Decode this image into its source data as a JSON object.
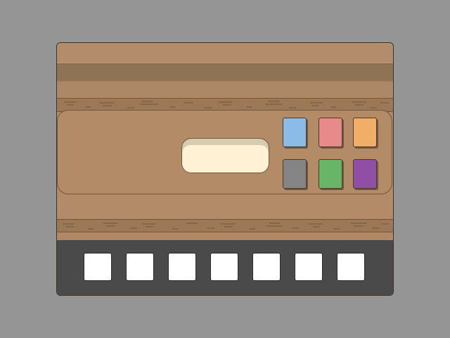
{
  "scene": {
    "background_color": "#959595",
    "cabinet_color": "#b38b68",
    "tray_color": "#4a4a4a"
  },
  "display": {
    "text": ""
  },
  "color_buttons": [
    {
      "name": "blue",
      "color": "#8bbce8"
    },
    {
      "name": "pink",
      "color": "#e88a8a"
    },
    {
      "name": "orange",
      "color": "#f0ae68"
    },
    {
      "name": "gray",
      "color": "#858585"
    },
    {
      "name": "green",
      "color": "#68b568"
    },
    {
      "name": "purple",
      "color": "#8e4fa5"
    }
  ],
  "slots": [
    {
      "index": 1,
      "filled": false
    },
    {
      "index": 2,
      "filled": false
    },
    {
      "index": 3,
      "filled": false
    },
    {
      "index": 4,
      "filled": false
    },
    {
      "index": 5,
      "filled": false
    },
    {
      "index": 6,
      "filled": false
    },
    {
      "index": 7,
      "filled": false
    }
  ]
}
